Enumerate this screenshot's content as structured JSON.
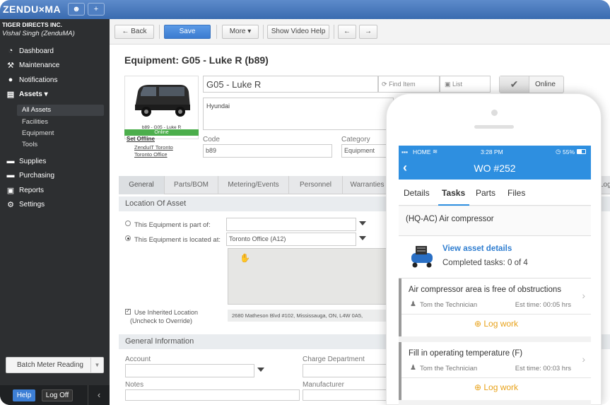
{
  "app": {
    "logo": "ZENDU×MA",
    "company": "TIGER DIRECTS INC.",
    "user": "Vishal Singh (ZenduMA)"
  },
  "sidebar": {
    "items": [
      {
        "label": "Dashboard",
        "icon": "dashboard-icon",
        "glyph": "◔"
      },
      {
        "label": "Maintenance",
        "icon": "tools-icon",
        "glyph": "⚒"
      },
      {
        "label": "Notifications",
        "icon": "chat-bubble-icon",
        "glyph": "●"
      },
      {
        "label": "Assets ▾",
        "icon": "boxes-icon",
        "glyph": "▤"
      },
      {
        "label": "Supplies",
        "icon": "cart-icon",
        "glyph": "▬"
      },
      {
        "label": "Purchasing",
        "icon": "shopping-cart-icon",
        "glyph": "▬"
      },
      {
        "label": "Reports",
        "icon": "chart-icon",
        "glyph": "▣"
      },
      {
        "label": "Settings",
        "icon": "gear-icon",
        "glyph": "⚙"
      }
    ],
    "sub_items": [
      "All Assets",
      "Facilities",
      "Equipment",
      "Tools"
    ],
    "batch_label": "Batch Meter Reading",
    "help_label": "Help",
    "logoff_label": "Log Off"
  },
  "toolbar": {
    "back": "← Back",
    "save": "Save",
    "more": "More ▾",
    "video": "Show Video Help",
    "prev": "←",
    "next": "→"
  },
  "equipment": {
    "page_title": "Equipment: G05 - Luke R (b89)",
    "photo_caption": "b89 - G05 - Luke R",
    "status": "Online",
    "set_offline": "Set Offline",
    "location_link1": "ZenduIT Toronto",
    "location_link2": "Toronto Office",
    "name": "G05 - Luke R",
    "find_item": "Find Item",
    "list": "List",
    "description": "Hyundai",
    "online_label": "Online",
    "code_label": "Code",
    "code_value": "b89",
    "category_label": "Category",
    "category_value": "Equipment"
  },
  "tabs": [
    "General",
    "Parts/BOM",
    "Metering/Events",
    "Personnel",
    "Warranties",
    "Log"
  ],
  "location": {
    "section": "Location Of Asset",
    "part_of_label": "This Equipment is part of:",
    "located_at_label": "This Equipment is located at:",
    "located_at_value": "Toronto Office (A12)",
    "inherited_label": "Use Inherited Location",
    "inherited_sub": "(Uncheck to Override)",
    "address": "2680 Matheson Blvd #102, Mississauga, ON, L4W 0A5,"
  },
  "general_info": {
    "section": "General Information",
    "account": "Account",
    "charge_department": "Charge Department",
    "notes": "Notes",
    "manufacturer": "Manufacturer"
  },
  "phone": {
    "carrier": "HOME",
    "time": "3:28 PM",
    "battery": "55%",
    "title": "WO #252",
    "tabs": [
      "Details",
      "Tasks",
      "Parts",
      "Files"
    ],
    "asset_name": "(HQ-AC) Air compressor",
    "view_asset": "View asset details",
    "completed": "Completed tasks: 0 of 4",
    "tasks": [
      {
        "title": "Air compressor area is free of obstructions",
        "tech": "Tom the Technician",
        "est": "Est time: 00:05 hrs",
        "log": "Log work"
      },
      {
        "title": "Fill in operating temperature (F)",
        "tech": "Tom the Technician",
        "est": "Est time: 00:03 hrs",
        "log": "Log work"
      }
    ]
  },
  "colors": {
    "accent": "#2e8fe0",
    "sidebar": "#2d2f31",
    "online": "#4cae4c",
    "log_work": "#e8a21a"
  }
}
